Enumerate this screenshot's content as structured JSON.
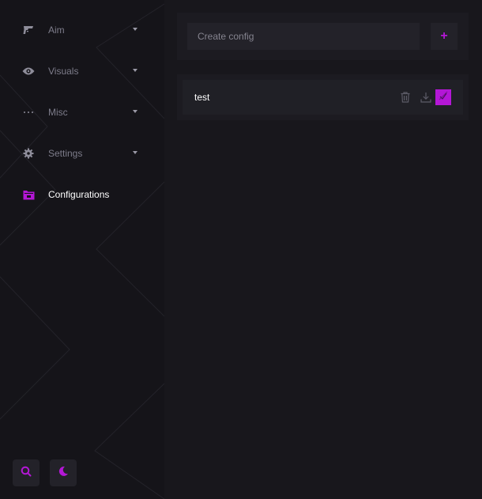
{
  "colors": {
    "accent": "#b417d6",
    "background": "#18171c",
    "sidebar_background": "#151419",
    "panel": "#1c1b21",
    "text_muted": "#7d7c8a",
    "text_active": "#ffffff"
  },
  "sidebar": {
    "items": [
      {
        "label": "Aim",
        "icon": "gun-icon",
        "has_dropdown": true
      },
      {
        "label": "Visuals",
        "icon": "eye-icon",
        "has_dropdown": true
      },
      {
        "label": "Misc",
        "icon": "ellipsis-icon",
        "has_dropdown": true
      },
      {
        "label": "Settings",
        "icon": "gear-icon",
        "has_dropdown": true
      },
      {
        "label": "Configurations",
        "icon": "folder-icon",
        "has_dropdown": false,
        "active": true
      }
    ],
    "bottom_buttons": [
      {
        "icon": "search-icon"
      },
      {
        "icon": "moon-icon"
      }
    ]
  },
  "main": {
    "create": {
      "placeholder": "Create config",
      "value": "",
      "add_label": "+"
    },
    "configs": [
      {
        "name": "test",
        "actions": [
          "trash-icon",
          "download-icon",
          "apply-icon"
        ]
      }
    ]
  }
}
